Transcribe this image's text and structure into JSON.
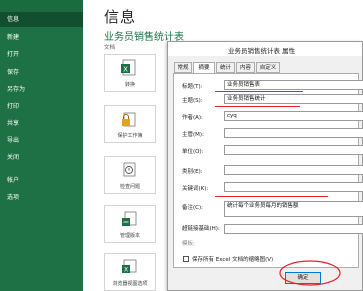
{
  "sidebar": {
    "items": [
      {
        "label": "信息",
        "active": true
      },
      {
        "label": "新建"
      },
      {
        "label": "打开"
      },
      {
        "label": "保存"
      },
      {
        "label": "另存为"
      },
      {
        "label": "打印"
      },
      {
        "label": "共享"
      },
      {
        "label": "导出"
      },
      {
        "label": "关闭"
      },
      {
        "label": "帐户"
      },
      {
        "label": "选项"
      }
    ]
  },
  "main": {
    "title": "信息",
    "doc_name": "业务员销售统计表",
    "doc_sub": "文档",
    "tiles": [
      {
        "label": "转换",
        "icon": "convert-icon"
      },
      {
        "label": "保护工作簿",
        "icon": "protect-workbook-icon"
      },
      {
        "label": "检查问题",
        "icon": "check-issues-icon"
      },
      {
        "label": "管理版本",
        "icon": "manage-versions-icon"
      },
      {
        "label": "浏览器视图选项",
        "icon": "browser-view-icon"
      }
    ]
  },
  "dialog": {
    "title": "业务员销售统计表 属性",
    "tabs": [
      "常规",
      "摘要",
      "统计",
      "内容",
      "自定义"
    ],
    "active_tab": "摘要",
    "fields": [
      {
        "label": "标题(T):",
        "value": "业务员销售表"
      },
      {
        "label": "主题(S):",
        "value": "业务员销售统计"
      },
      {
        "label": "作者(A):",
        "value": "cyq"
      },
      {
        "label": "主管(M):",
        "value": ""
      },
      {
        "label": "单位(O):",
        "value": ""
      },
      {
        "label": "类别(E):",
        "value": ""
      },
      {
        "label": "关键词(K):",
        "value": ""
      },
      {
        "label": "备注(C):",
        "value": "统计每个业务员每月的销售额"
      },
      {
        "label": "超链接基础(H):",
        "value": ""
      },
      {
        "label": "模板:",
        "value": ""
      }
    ],
    "save_thumbnail_label": "保存所有 Excel 文档的缩略图(V)",
    "ok_label": "确定"
  },
  "colors": {
    "sidebar_bg": "#1e7145",
    "accent_green": "#1e7145",
    "annotation_red": "#e8212b"
  }
}
